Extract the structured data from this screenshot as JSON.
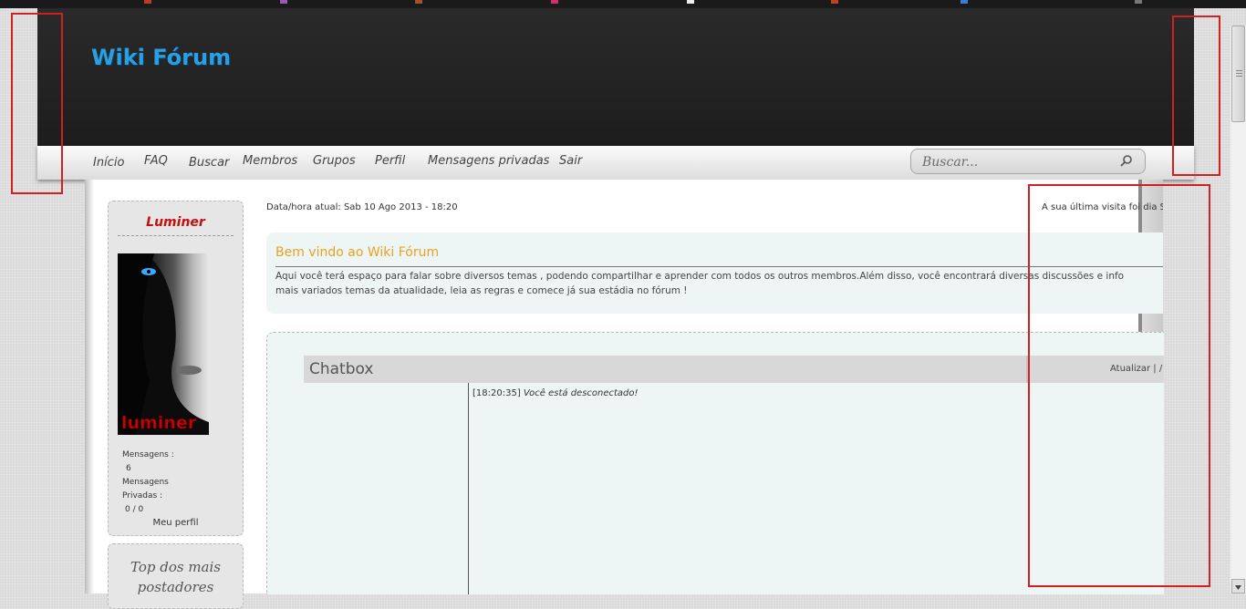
{
  "site": {
    "logo": "Wiki Fórum"
  },
  "nav": {
    "items": [
      {
        "label": "Início"
      },
      {
        "label": "FAQ"
      },
      {
        "label": "Buscar"
      },
      {
        "label": "Membros"
      },
      {
        "label": "Grupos"
      },
      {
        "label": "Perfil"
      },
      {
        "label": "Mensagens privadas"
      },
      {
        "label": "Sair"
      }
    ],
    "search_placeholder": "Buscar..."
  },
  "profile": {
    "username": "Luminer",
    "avatar_text": "luminer",
    "posts_label": "Mensagens :",
    "posts_value": "6",
    "pm_label_line1": "Mensagens",
    "pm_label_line2": "Privadas :",
    "pm_value": "0 / 0",
    "profile_link": "Meu perfil"
  },
  "top_posters": {
    "title": "Top dos mais postadores"
  },
  "main": {
    "datetime": "Data/hora atual: Sab 10 Ago 2013 - 18:20",
    "last_visit": "A sua última visita foi dia S",
    "welcome_title": "Bem vindo ao Wiki Fórum",
    "welcome_line1": "Aqui você terá espaço para falar sobre diversos temas , podendo compartilhar e aprender com todos os outros membros.Além disso, você encontrará diversas discussões e info",
    "welcome_line2": "mais variados temas da atualidade, leia as regras e comece já sua estádia no fórum !"
  },
  "chatbox": {
    "title": "Chatbox",
    "actions": "Atualizar  |  /",
    "time": "[18:20:35]",
    "message": "Você está desconectado!"
  },
  "colors": {
    "logo": "#2b9fe0",
    "username": "#c41010",
    "welcome_title": "#e9a21d",
    "highlight_box": "#d02020"
  }
}
